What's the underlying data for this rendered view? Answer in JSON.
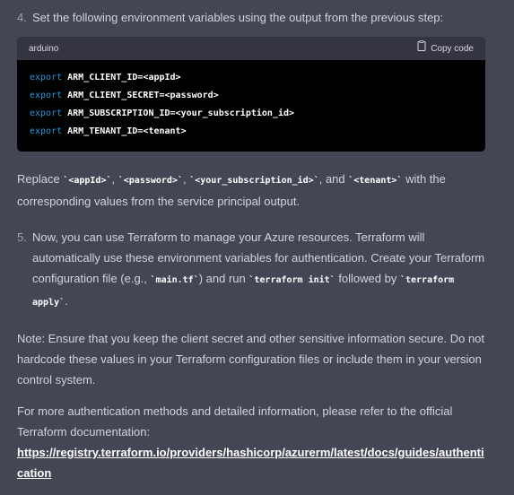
{
  "step4": {
    "number": "4.",
    "text": "Set the following environment variables using the output from the previous step:"
  },
  "code": {
    "language": "arduino",
    "copy_label": "Copy code",
    "lines": [
      {
        "keyword": "export",
        "rest": " ARM_CLIENT_ID=<appId>"
      },
      {
        "keyword": "export",
        "rest": " ARM_CLIENT_SECRET=<password>"
      },
      {
        "keyword": "export",
        "rest": " ARM_SUBSCRIPTION_ID=<your_subscription_id>"
      },
      {
        "keyword": "export",
        "rest": " ARM_TENANT_ID=<tenant>"
      }
    ]
  },
  "replace": {
    "t1": "Replace ",
    "c1": "`<appId>`",
    "t2": ", ",
    "c2": "`<password>`",
    "t3": ", ",
    "c3": "`<your_subscription_id>`",
    "t4": ", and ",
    "c4": "`<tenant>`",
    "t5": " with the corresponding values from the service principal output."
  },
  "step5": {
    "number": "5.",
    "t1": "Now, you can use Terraform to manage your Azure resources. Terraform will automatically use these environment variables for authentication. Create your Terraform configuration file (e.g., ",
    "c1": "`main.tf`",
    "t2": ") and run ",
    "c2": "`terraform init`",
    "t3": " followed by ",
    "c3": "`terraform apply`",
    "t4": "."
  },
  "note": "Note: Ensure that you keep the client secret and other sensitive information secure. Do not hardcode these values in your Terraform configuration files or include them in your version control system.",
  "more": {
    "text": "For more authentication methods and detailed information, please refer to the official Terraform documentation:",
    "link": "https://registry.terraform.io/providers/hashicorp/azurerm/latest/docs/guides/authentication"
  }
}
